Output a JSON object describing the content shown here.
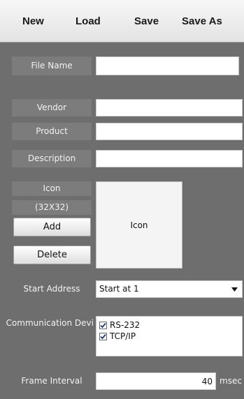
{
  "toolbar": {
    "new_label": "New",
    "load_label": "Load",
    "save_label": "Save",
    "save_as_label": "Save As"
  },
  "form": {
    "file_name_label": "File Name",
    "file_name_value": "",
    "vendor_label": "Vendor",
    "vendor_value": "",
    "product_label": "Product",
    "product_value": "",
    "description_label": "Description",
    "description_value": "",
    "icon_label": "Icon",
    "icon_size_label": "(32X32)",
    "add_button": "Add",
    "delete_button": "Delete",
    "icon_preview_text": "Icon",
    "start_address_label": "Start Address",
    "start_address_value": "Start at 1",
    "communication_label": "Communication Devi",
    "communication_devices": [
      {
        "label": "RS-232",
        "checked": true
      },
      {
        "label": "TCP/IP",
        "checked": true
      }
    ],
    "frame_interval_label": "Frame Interval",
    "frame_interval_value": "40",
    "frame_interval_unit": "msec"
  }
}
